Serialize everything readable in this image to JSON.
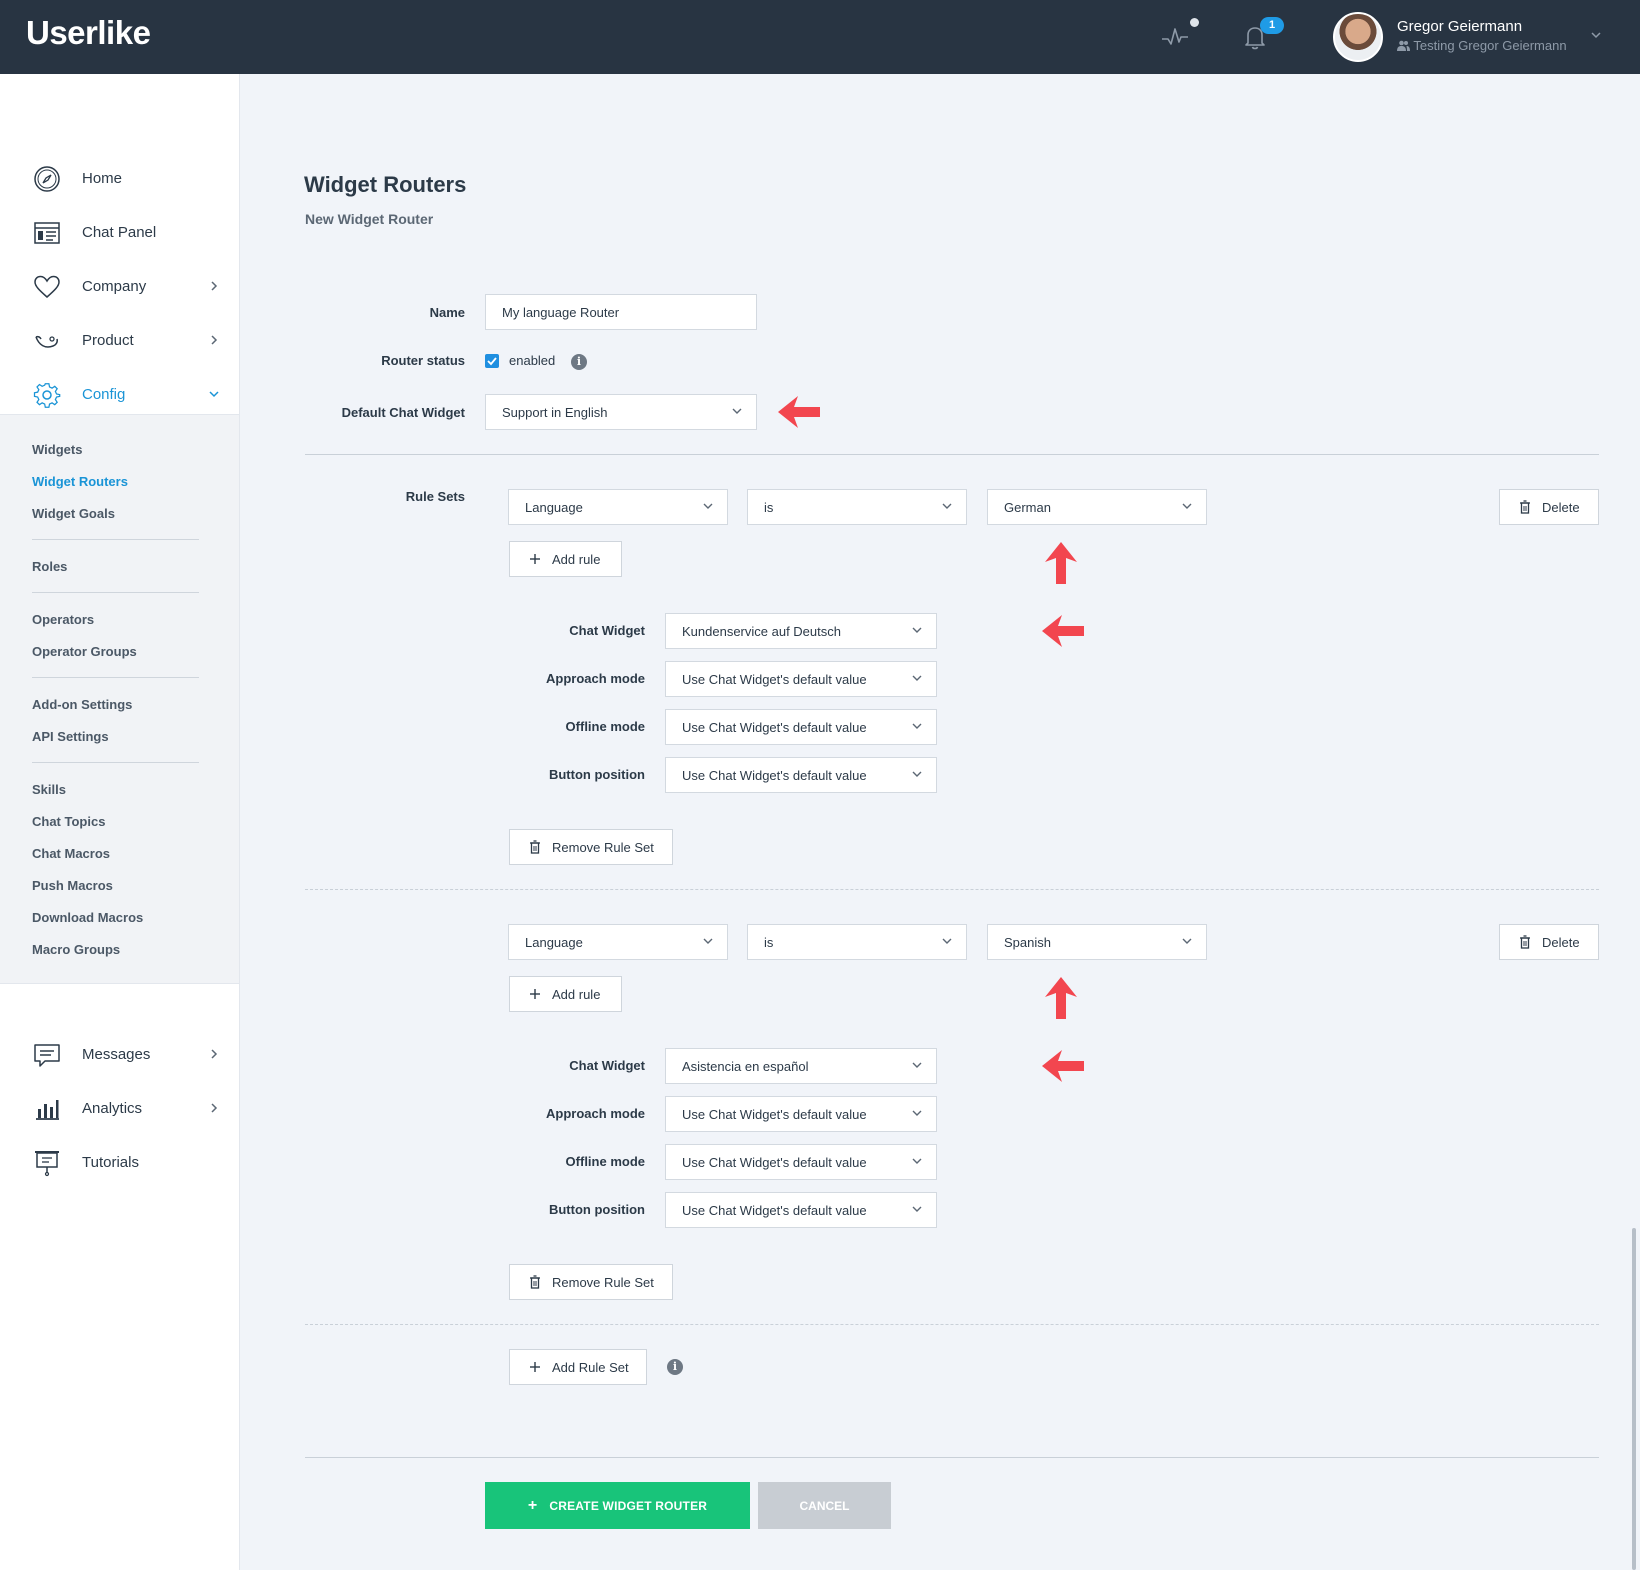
{
  "topbar": {
    "logo": "Userlike",
    "notifications_count": "1",
    "user_name": "Gregor Geiermann",
    "user_sub": "Testing Gregor Geiermann"
  },
  "sidebar": {
    "items": [
      {
        "label": "Home",
        "icon": "compass-icon"
      },
      {
        "label": "Chat Panel",
        "icon": "chat-panel-icon"
      },
      {
        "label": "Company",
        "icon": "heart-icon"
      },
      {
        "label": "Product",
        "icon": "product-icon"
      },
      {
        "label": "Config",
        "icon": "gear-icon"
      }
    ],
    "sub_items": [
      "Widgets",
      "Widget Routers",
      "Widget Goals",
      "Roles",
      "Operators",
      "Operator Groups",
      "Add-on Settings",
      "API Settings",
      "Skills",
      "Chat Topics",
      "Chat Macros",
      "Push Macros",
      "Download Macros",
      "Macro Groups"
    ],
    "bottom_items": [
      {
        "label": "Messages",
        "icon": "messages-icon"
      },
      {
        "label": "Analytics",
        "icon": "analytics-icon"
      },
      {
        "label": "Tutorials",
        "icon": "tutorials-icon"
      }
    ]
  },
  "main": {
    "title": "Widget Routers",
    "subtitle": "New Widget Router",
    "name_label": "Name",
    "name_value": "My language Router",
    "status_label": "Router status",
    "status_checked": true,
    "status_text": "enabled",
    "default_label": "Default Chat Widget",
    "default_value": "Support in English",
    "rule_sets_label": "Rule Sets",
    "rule_sets": [
      {
        "field": "Language",
        "op": "is",
        "value": "German",
        "delete": "Delete",
        "add_rule": "Add rule",
        "chat_widget_label": "Chat Widget",
        "chat_widget": "Kundenservice auf Deutsch",
        "approach_label": "Approach mode",
        "approach": "Use Chat Widget's default value",
        "offline_label": "Offline mode",
        "offline": "Use Chat Widget's default value",
        "button_label": "Button position",
        "button": "Use Chat Widget's default value",
        "remove": "Remove Rule Set"
      },
      {
        "field": "Language",
        "op": "is",
        "value": "Spanish",
        "delete": "Delete",
        "add_rule": "Add rule",
        "chat_widget_label": "Chat Widget",
        "chat_widget": "Asistencia en español",
        "approach_label": "Approach mode",
        "approach": "Use Chat Widget's default value",
        "offline_label": "Offline mode",
        "offline": "Use Chat Widget's default value",
        "button_label": "Button position",
        "button": "Use Chat Widget's default value",
        "remove": "Remove Rule Set"
      }
    ],
    "add_rule_set": "Add Rule Set",
    "create": "CREATE WIDGET ROUTER",
    "cancel": "CANCEL"
  },
  "colors": {
    "accent": "#1a94d6",
    "create": "#18c47a",
    "annotation": "#f2464f",
    "topbar": "#283442"
  }
}
